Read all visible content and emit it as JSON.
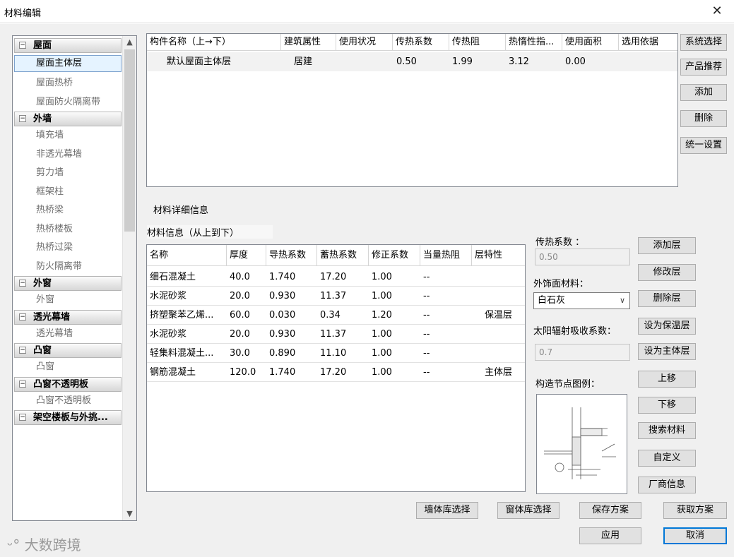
{
  "window": {
    "title": "材料编辑",
    "close_glyph": "✕"
  },
  "tree": {
    "groups": [
      {
        "label": "屋面",
        "items": [
          "屋面主体层",
          "屋面热桥",
          "屋面防火隔离带"
        ]
      },
      {
        "label": "外墙",
        "items": [
          "填充墙",
          "非透光幕墙",
          "剪力墙",
          "框架柱",
          "热桥梁",
          "热桥楼板",
          "热桥过梁",
          "防火隔离带"
        ]
      },
      {
        "label": "外窗",
        "items": [
          "外窗"
        ]
      },
      {
        "label": "透光幕墙",
        "items": [
          "透光幕墙"
        ]
      },
      {
        "label": "凸窗",
        "items": [
          "凸窗"
        ]
      },
      {
        "label": "凸窗不透明板",
        "items": [
          "凸窗不透明板"
        ]
      },
      {
        "label": "架空楼板与外挑...",
        "items": []
      }
    ],
    "selected": "屋面主体层",
    "collapse_glyph": "−"
  },
  "component_table": {
    "headers": [
      "构件名称（上→下）",
      "建筑属性",
      "使用状况",
      "传热系数",
      "传热阻",
      "热惰性指...",
      "使用面积",
      "选用依据"
    ],
    "rows": [
      [
        "默认屋面主体层",
        "居建",
        "",
        "0.50",
        "1.99",
        "3.12",
        "0.00",
        ""
      ]
    ]
  },
  "side_buttons": [
    "系统选择",
    "产品推荐",
    "添加",
    "删除",
    "统一设置"
  ],
  "detail": {
    "section_title": "材料详细信息",
    "subtitle": "材料信息（从上到下）",
    "headers": [
      "名称",
      "厚度",
      "导热系数",
      "蓄热系数",
      "修正系数",
      "当量热阻",
      "层特性"
    ],
    "rows": [
      [
        "细石混凝土",
        "40.0",
        "1.740",
        "17.20",
        "1.00",
        "--",
        ""
      ],
      [
        "水泥砂浆",
        "20.0",
        "0.930",
        "11.37",
        "1.00",
        "--",
        ""
      ],
      [
        "挤塑聚苯乙烯...",
        "60.0",
        "0.030",
        "0.34",
        "1.20",
        "--",
        "保温层"
      ],
      [
        "水泥砂浆",
        "20.0",
        "0.930",
        "11.37",
        "1.00",
        "--",
        ""
      ],
      [
        "轻集料混凝土...",
        "30.0",
        "0.890",
        "11.10",
        "1.00",
        "--",
        ""
      ],
      [
        "钢筋混凝土",
        "120.0",
        "1.740",
        "17.20",
        "1.00",
        "--",
        "主体层"
      ]
    ]
  },
  "props": {
    "u_label": "传热系数 ：",
    "u_value": "0.50",
    "finish_label": "外饰面材料：",
    "finish_value": "白石灰",
    "solar_label": "太阳辐射吸收系数：",
    "solar_value": "0.7",
    "node_label": "构造节点图例："
  },
  "layer_buttons": [
    "添加层",
    "修改层",
    "删除层",
    "设为保温层",
    "设为主体层",
    "上移",
    "下移",
    "搜索材料",
    "自定义",
    "厂商信息"
  ],
  "bottom_buttons": {
    "wall_lib": "墙体库选择",
    "window_lib": "窗体库选择",
    "save_scheme": "保存方案",
    "get_scheme": "获取方案",
    "apply": "应用",
    "cancel": "取消"
  },
  "watermark": "大数跨境",
  "colors": {
    "selection_border": "#0078d7",
    "tree_selected_bg": "#e5f3ff"
  }
}
